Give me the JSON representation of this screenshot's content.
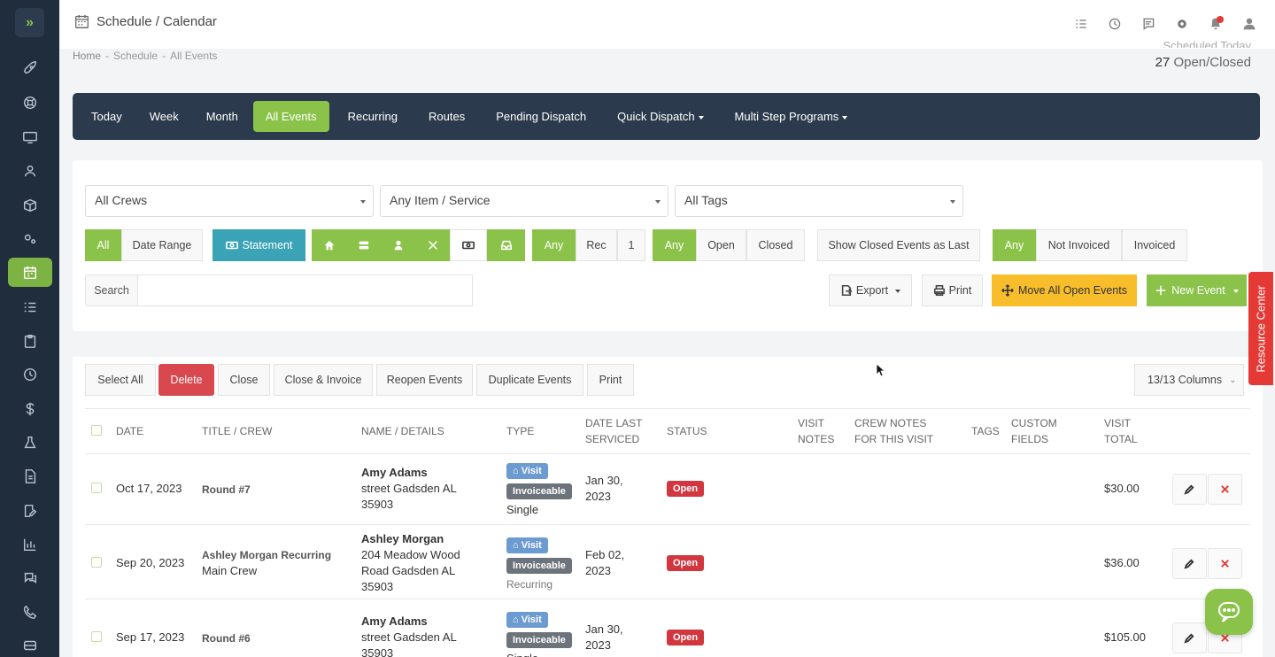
{
  "topbar": {
    "title": "Schedule / Calendar"
  },
  "breadcrumb": {
    "home": "Home",
    "sep": "-",
    "schedule": "Schedule",
    "current": "All Events"
  },
  "stats": {
    "count": "27",
    "label": "Open/Closed",
    "hidden_label": "Scheduled Today"
  },
  "nav": [
    {
      "label": "Today"
    },
    {
      "label": "Week"
    },
    {
      "label": "Month"
    },
    {
      "label": "All Events"
    },
    {
      "label": "Recurring"
    },
    {
      "label": "Routes"
    },
    {
      "label": "Pending Dispatch"
    },
    {
      "label": "Quick Dispatch"
    },
    {
      "label": "Multi Step Programs"
    }
  ],
  "filters": {
    "crews": "All Crews",
    "item": "Any Item / Service",
    "tags": "All Tags",
    "all": "All",
    "date_range": "Date Range",
    "statement": "Statement",
    "rec_any": "Any",
    "rec": "Rec",
    "rec_count": "1",
    "status_any": "Any",
    "status_open": "Open",
    "status_closed": "Closed",
    "show_closed_last": "Show Closed Events as Last",
    "inv_any": "Any",
    "not_invoiced": "Not Invoiced",
    "invoiced": "Invoiced",
    "search_label": "Search",
    "export": "Export",
    "print": "Print",
    "move_all": "Move All Open Events",
    "new_event": "New Event"
  },
  "bulk": {
    "select_all": "Select All",
    "delete": "Delete",
    "close": "Close",
    "close_invoice": "Close & Invoice",
    "reopen": "Reopen Events",
    "duplicate": "Duplicate Events",
    "print": "Print",
    "columns": "13/13 Columns"
  },
  "table": {
    "headers": {
      "date": "DATE",
      "title_crew": "TITLE / CREW",
      "name": "NAME / DETAILS",
      "type": "TYPE",
      "date_last_1": "DATE LAST",
      "date_last_2": "SERVICED",
      "status": "STATUS",
      "visit_notes_1": "VISIT",
      "visit_notes_2": "NOTES",
      "crew_notes_1": "CREW NOTES",
      "crew_notes_2": "FOR THIS VISIT",
      "tags": "TAGS",
      "custom_1": "CUSTOM",
      "custom_2": "FIELDS",
      "total_1": "VISIT",
      "total_2": "TOTAL"
    },
    "rows": [
      {
        "date": "Oct 17, 2023",
        "title": "Round #7",
        "crew": "",
        "name": "Amy Adams",
        "addr1": "street Gadsden AL",
        "addr2": "35903",
        "addr3": "",
        "visit": "Visit",
        "invoiceable": "Invoiceable",
        "kind": "Single",
        "last1": "Jan 30,",
        "last2": "2023",
        "status": "Open",
        "total": "$30.00"
      },
      {
        "date": "Sep 20, 2023",
        "title": "Ashley Morgan Recurring",
        "crew": "Main Crew",
        "name": "Ashley Morgan",
        "addr1": "204 Meadow Wood",
        "addr2": "Road Gadsden AL",
        "addr3": "35903",
        "visit": "Visit",
        "invoiceable": "Invoiceable",
        "kind": "Recurring",
        "last1": "Feb 02,",
        "last2": "2023",
        "status": "Open",
        "total": "$36.00"
      },
      {
        "date": "Sep 17, 2023",
        "title": "Round #6",
        "crew": "",
        "name": "Amy Adams",
        "addr1": "street Gadsden AL",
        "addr2": "35903",
        "addr3": "",
        "visit": "Visit",
        "invoiceable": "Invoiceable",
        "kind": "Single",
        "last1": "Jan 30,",
        "last2": "2023",
        "status": "Open",
        "total": "$105.00"
      }
    ]
  },
  "resource_center": "Resource Center",
  "colors": {
    "sidebar": "#1f2d3d",
    "accent_green": "#8bc34a",
    "navbar": "#2c3a4d",
    "danger": "#d9474f",
    "warning": "#f7bd2a",
    "teal": "#3aa3b5"
  }
}
